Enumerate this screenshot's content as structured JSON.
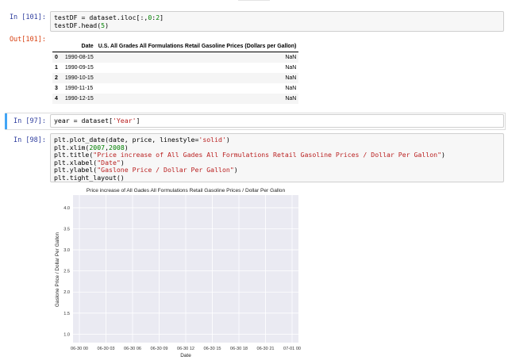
{
  "cells": [
    {
      "prompt": "In [101]:",
      "lines": [
        "testDF = dataset.iloc[:,0:2]",
        "testDF.head(5)"
      ]
    },
    {
      "prompt": "In [97]:",
      "lines": [
        "year = dataset['Year']"
      ]
    },
    {
      "prompt": "In [98]:",
      "lines": [
        "plt.plot_date(date, price, linestyle='solid')",
        "plt.xlim(2007,2008)",
        "plt.title(\"Price increase of All Gades All Formulations Retail Gasoline Prices / Dollar Per Gallon\")",
        "plt.xlabel(\"Date\")",
        "plt.ylabel(\"Gaslone Price / Dollar Per Gallon\")",
        "plt.tight_layout()"
      ]
    }
  ],
  "output": {
    "prompt": "Out[101]:",
    "columns": [
      "Date",
      "U.S. All Grades All Formulations Retail Gasoline Prices (Dollars per Gallon)"
    ],
    "rows": [
      {
        "index": "0",
        "date": "1990-08-15",
        "value": "NaN"
      },
      {
        "index": "1",
        "date": "1990-09-15",
        "value": "NaN"
      },
      {
        "index": "2",
        "date": "1990-10-15",
        "value": "NaN"
      },
      {
        "index": "3",
        "date": "1990-11-15",
        "value": "NaN"
      },
      {
        "index": "4",
        "date": "1990-12-15",
        "value": "NaN"
      }
    ]
  },
  "colors": {
    "plot_bg": "#eaeaf2",
    "grid": "#ffffff",
    "in_prompt": "#303f9f",
    "out_prompt": "#d84315",
    "selection": "#42a5f5"
  },
  "chart_data": {
    "type": "line",
    "title": "Price increase of All Gades All Formulations Retail Gasoline Prices / Dollar Per Gallon",
    "xlabel": "Date",
    "ylabel": "Gaslone Price / Dollar Per Gallon",
    "x_ticks": [
      "06-30 00",
      "06-30 03",
      "06-30 06",
      "06-30 09",
      "06-30 12",
      "06-30 15",
      "06-30 18",
      "06-30 21",
      "07-01 00"
    ],
    "y_ticks": [
      "1.0",
      "1.5",
      "2.0",
      "2.5",
      "3.0",
      "3.5",
      "4.0"
    ],
    "ylim": [
      0.8,
      4.3
    ],
    "grid": true,
    "series": []
  }
}
